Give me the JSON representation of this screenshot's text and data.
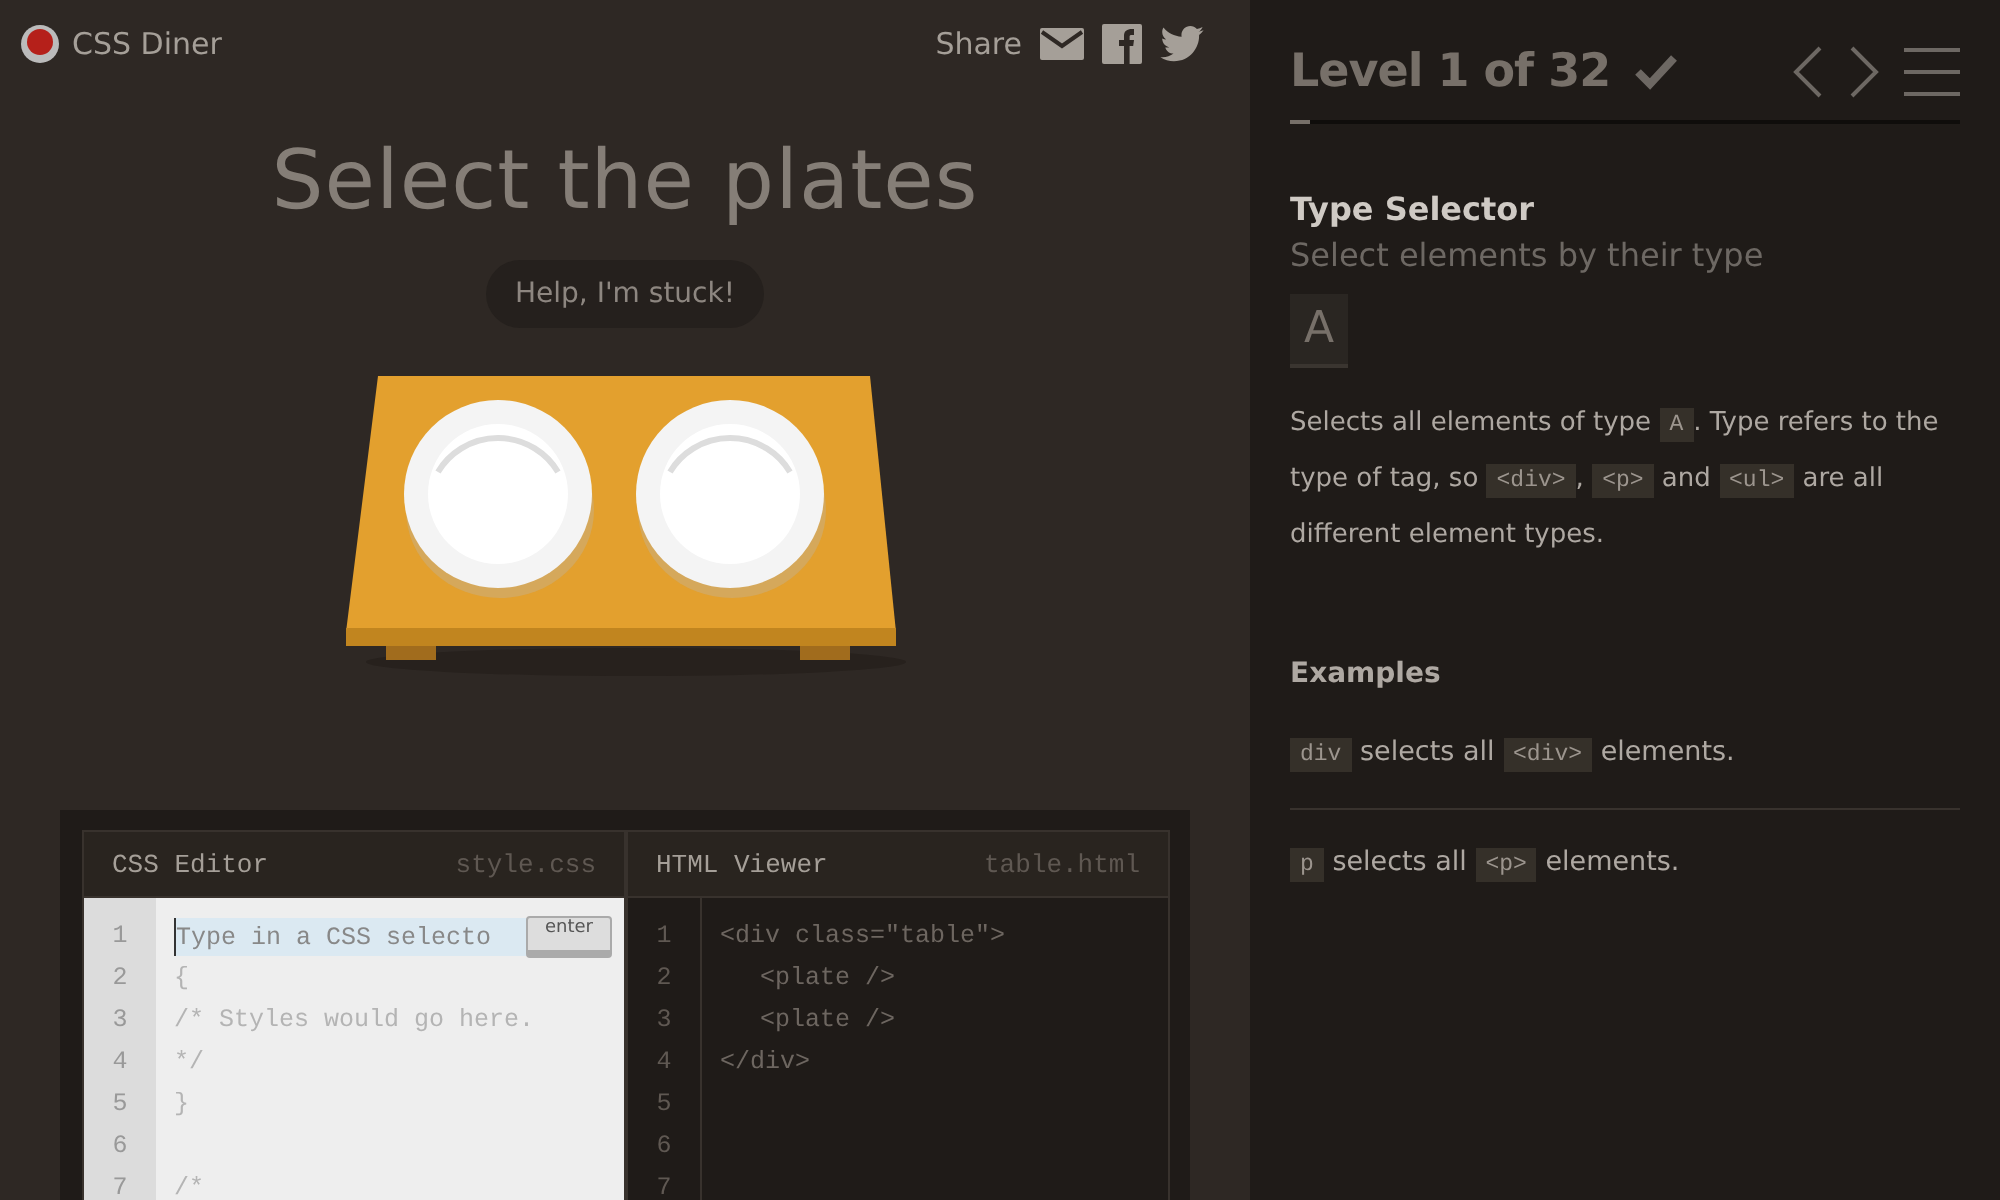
{
  "header": {
    "brand": "CSS Diner",
    "share": "Share"
  },
  "instruction": "Select the plates",
  "help_button": "Help, I'm stuck!",
  "table": {
    "plates": [
      {
        "kind": "plate"
      },
      {
        "kind": "plate"
      }
    ]
  },
  "css_editor": {
    "title": "CSS Editor",
    "file": "style.css",
    "placeholder": "Type in a CSS selecto",
    "enter_button": "enter",
    "line_numbers": [
      "1",
      "2",
      "3",
      "4",
      "5",
      "6",
      "7"
    ],
    "lines": [
      {
        "kind": "code",
        "text": "{"
      },
      {
        "kind": "code",
        "text": "/* Styles would go here."
      },
      {
        "kind": "code",
        "text": "*/"
      },
      {
        "kind": "code",
        "text": "}"
      },
      {
        "kind": "blank"
      },
      {
        "kind": "code",
        "text": "/*"
      }
    ]
  },
  "html_viewer": {
    "title": "HTML Viewer",
    "file": "table.html",
    "line_numbers": [
      "1",
      "2",
      "3",
      "4",
      "5",
      "6",
      "7"
    ],
    "lines": [
      {
        "text": "<div class=\"table\">",
        "indent": false
      },
      {
        "text": "<plate />",
        "indent": true
      },
      {
        "text": "<plate />",
        "indent": true
      },
      {
        "text": "</div>",
        "indent": false
      }
    ]
  },
  "level_panel": {
    "title": "Level 1 of 32",
    "completed": true,
    "progress": {
      "level": 0.03
    },
    "selector_name": "Type Selector",
    "subtitle": "Select elements by their type",
    "syntax": "A",
    "description": [
      {
        "kind": "text",
        "text": "Selects all elements of type "
      },
      {
        "kind": "code",
        "text": "A"
      },
      {
        "kind": "text",
        "text": ". Type refers to the type of tag, so "
      },
      {
        "kind": "code",
        "text": "<div>"
      },
      {
        "kind": "text",
        "text": ", "
      },
      {
        "kind": "code",
        "text": "<p>"
      },
      {
        "kind": "text",
        "text": " and "
      },
      {
        "kind": "code",
        "text": "<ul>"
      },
      {
        "kind": "text",
        "text": " are all different element types."
      }
    ],
    "examples_title": "Examples",
    "examples": [
      [
        {
          "kind": "code",
          "text": "div"
        },
        {
          "kind": "text",
          "text": " selects all "
        },
        {
          "kind": "code",
          "text": "<div>"
        },
        {
          "kind": "text",
          "text": " elements."
        }
      ],
      [
        {
          "kind": "code",
          "text": "p"
        },
        {
          "kind": "text",
          "text": " selects all "
        },
        {
          "kind": "code",
          "text": "<p>"
        },
        {
          "kind": "text",
          "text": " elements."
        }
      ]
    ]
  }
}
